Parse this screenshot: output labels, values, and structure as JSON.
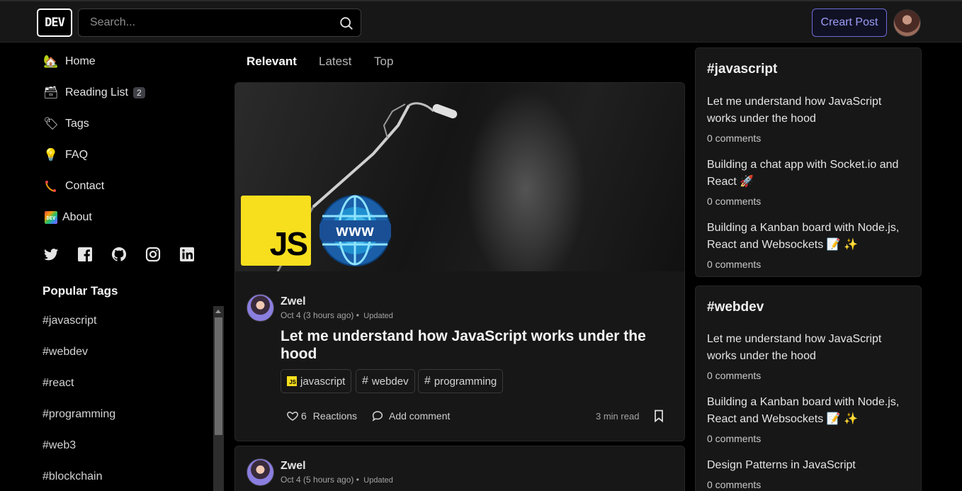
{
  "header": {
    "logo": "DEV",
    "search_placeholder": "Search...",
    "create_post": "Creart Post"
  },
  "sidebar": {
    "items": [
      {
        "label": "Home",
        "icon": "house-icon"
      },
      {
        "label": "Reading List",
        "icon": "reading-list-icon",
        "badge": "2"
      },
      {
        "label": "Tags",
        "icon": "tag-icon"
      },
      {
        "label": "FAQ",
        "icon": "lightbulb-icon"
      },
      {
        "label": "Contact",
        "icon": "contact-icon"
      },
      {
        "label": "About",
        "icon": "dev-rainbow-icon"
      }
    ],
    "social": [
      "twitter-icon",
      "facebook-icon",
      "github-icon",
      "instagram-icon",
      "linkedin-icon"
    ],
    "popular_title": "Popular Tags",
    "tags": [
      "#javascript",
      "#webdev",
      "#react",
      "#programming",
      "#web3",
      "#blockchain"
    ]
  },
  "feed": {
    "tabs": [
      "Relevant",
      "Latest",
      "Top"
    ],
    "posts": [
      {
        "author": "Zwel",
        "date": "Oct 4 (3 hours ago)",
        "updated": "Updated",
        "title": "Let me understand how JavaScript works under the hood",
        "tags": [
          {
            "label": "javascript",
            "hash": "JS"
          },
          {
            "label": "webdev",
            "hash": "#"
          },
          {
            "label": "programming",
            "hash": "#"
          }
        ],
        "cover_js": "JS",
        "cover_www": "www",
        "reactions_count": "6",
        "reactions_label": "Reactions",
        "comment_label": "Add comment",
        "read_time": "3 min read"
      },
      {
        "author": "Zwel",
        "date": "Oct 4 (5 hours ago)",
        "updated": "Updated"
      }
    ]
  },
  "right": {
    "widgets": [
      {
        "title": "#javascript",
        "items": [
          {
            "title": "Let me understand how JavaScript works under the hood",
            "comments": "0 comments"
          },
          {
            "title": "Building a chat app with Socket.io and React 🚀",
            "comments": "0 comments"
          },
          {
            "title": "Building a Kanban board with Node.js, React and Websockets 📝 ✨",
            "comments": "0 comments"
          }
        ]
      },
      {
        "title": "#webdev",
        "items": [
          {
            "title": "Let me understand how JavaScript works under the hood",
            "comments": "0 comments"
          },
          {
            "title": "Building a Kanban board with Node.js, React and Websockets 📝 ✨",
            "comments": "0 comments"
          },
          {
            "title": "Design Patterns in JavaScript",
            "comments": "0 comments"
          }
        ]
      }
    ]
  },
  "colors": {
    "accent": "#6d6bd6",
    "background": "#000000",
    "card": "#171717",
    "js_yellow": "#f7df1e"
  }
}
